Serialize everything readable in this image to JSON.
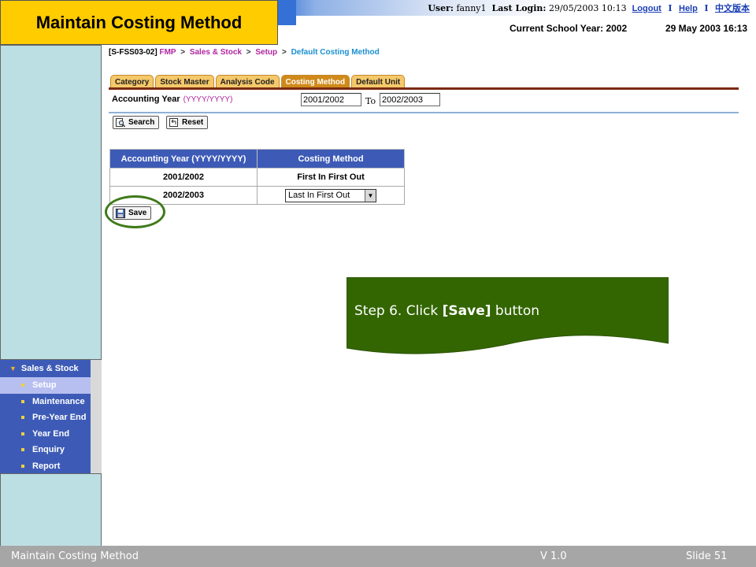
{
  "title": "Maintain Costing Method",
  "header": {
    "user_label": "User:",
    "user_name": "fanny1",
    "last_login_label": "Last Login:",
    "last_login_value": "29/05/2003 10:13",
    "logout": "Logout",
    "help": "Help",
    "chinese": "中文版本",
    "separator": "I",
    "school_year": "Current School Year: 2002",
    "datetime": "29 May 2003 16:13"
  },
  "sidebar": {
    "heading": "Sales & Stock",
    "items": [
      {
        "label": "Setup",
        "active": true
      },
      {
        "label": "Maintenance"
      },
      {
        "label": "Pre-Year End"
      },
      {
        "label": "Year End"
      },
      {
        "label": "Enquiry"
      },
      {
        "label": "Report"
      }
    ]
  },
  "breadcrumb": {
    "code": "[S-FSS03-02]",
    "items": [
      "FMP",
      "Sales & Stock",
      "Setup"
    ],
    "separator": ">",
    "current": "Default Costing Method"
  },
  "tabs": [
    {
      "label": "Category"
    },
    {
      "label": "Stock Master"
    },
    {
      "label": "Analysis Code"
    },
    {
      "label": "Costing Method",
      "active": true
    },
    {
      "label": "Default Unit"
    }
  ],
  "filter": {
    "label": "Accounting Year",
    "format": "(YYYY/YYYY)",
    "from_value": "2001/2002",
    "to_label": "To",
    "to_value": "2002/2003"
  },
  "buttons": {
    "search": "Search",
    "reset": "Reset",
    "save": "Save"
  },
  "table": {
    "headers": [
      "Accounting Year (YYYY/YYYY)",
      "Costing Method"
    ],
    "rows": [
      {
        "year": "2001/2002",
        "method": "First In First Out"
      },
      {
        "year": "2002/2003",
        "method": "Last In First Out"
      }
    ]
  },
  "callout": {
    "prefix": "Step 6. Click ",
    "bold": "[Save]",
    "suffix": " button",
    "color": "#336600"
  },
  "footer": {
    "left": "Maintain Costing Method",
    "middle": "V 1.0",
    "right": "Slide 51"
  },
  "colors": {
    "title_bg": "#ffcc00",
    "menu_bg": "#3d5bb6",
    "table_header_bg": "#3d5bb6",
    "tab_bg": "#f5c86a",
    "tab_active_bg": "#d08a1a",
    "highlight_ring": "#3f7a1a"
  }
}
